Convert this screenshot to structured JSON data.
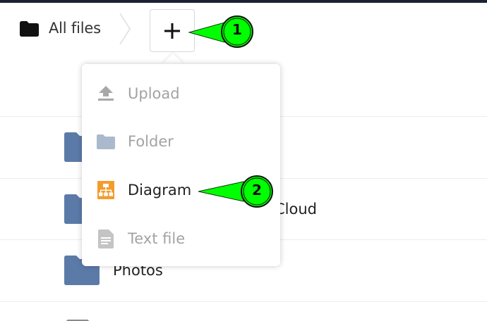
{
  "breadcrumb": {
    "home_label": "All files"
  },
  "toolbar": {
    "add_label": "+"
  },
  "files": [
    {
      "name": ""
    },
    {
      "name": "Cloud"
    },
    {
      "name": "Photos"
    }
  ],
  "menu": {
    "items": [
      {
        "label": "Upload",
        "icon": "upload-icon",
        "enabled": false
      },
      {
        "label": "Folder",
        "icon": "folder-icon",
        "enabled": false
      },
      {
        "label": "Diagram",
        "icon": "diagram-icon",
        "enabled": true
      },
      {
        "label": "Text file",
        "icon": "text-file-icon",
        "enabled": false
      }
    ]
  },
  "annotations": [
    {
      "number": "1"
    },
    {
      "number": "2"
    }
  ],
  "colors": {
    "folder": "#5b7aa8",
    "folder_muted": "#aab9cd",
    "diagram_accent": "#f39c2e",
    "callout_green": "#00ff00",
    "topbar": "#1b2130"
  }
}
